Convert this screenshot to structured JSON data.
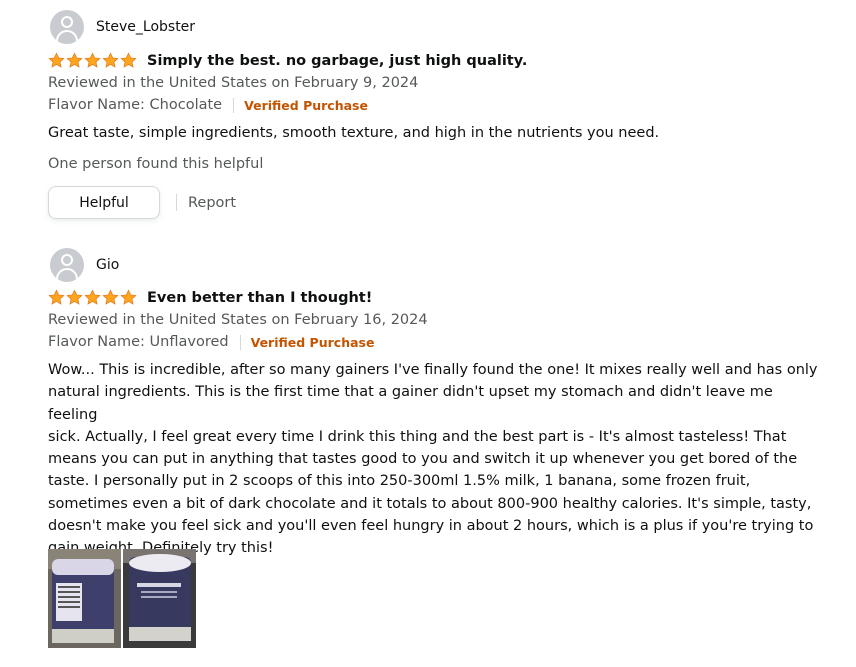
{
  "reviews": [
    {
      "profile_name": "Steve_Lobster",
      "rating": 5,
      "title": "Simply the best. no garbage, just high quality.",
      "date_line": "Reviewed in the United States on February 9, 2024",
      "format": "Flavor Name: Chocolate",
      "verified": "Verified Purchase",
      "body": "Great taste, simple ingredients, smooth texture, and high in the nutrients you need.",
      "helpful_count_text": "One person found this helpful",
      "helpful_button": "Helpful",
      "report_link": "Report"
    },
    {
      "profile_name": "Gio",
      "rating": 5,
      "title": "Even better than I thought!",
      "date_line": "Reviewed in the United States on February 16, 2024",
      "format": "Flavor Name: Unflavored",
      "verified": "Verified Purchase",
      "body_lines": [
        "Wow... This is incredible, after so many gainers I've finally found the one! It mixes really well and has only",
        "natural ingredients. This is the first time that a gainer didn't upset my stomach and didn't leave me feeling",
        "sick. Actually, I feel great every time I drink this thing and the best part is - It's almost tasteless! That",
        "means you can put in anything that tastes good to you and switch it up whenever you get bored of the",
        "taste. I personally put in 2 scoops of this into 250-300ml 1.5% milk, 1 banana, some frozen fruit,",
        "sometimes even a bit of dark chocolate and it totals to about 800-900 healthy calories. It's simple, tasty,",
        "doesn't make you feel sick and you'll even feel hungry in about 2 hours, which is a plus if you're trying to",
        "gain weight. Definitely try this!"
      ]
    }
  ],
  "colors": {
    "star": "#ffa41c",
    "verified": "#c45500",
    "muted_text": "#565959"
  }
}
